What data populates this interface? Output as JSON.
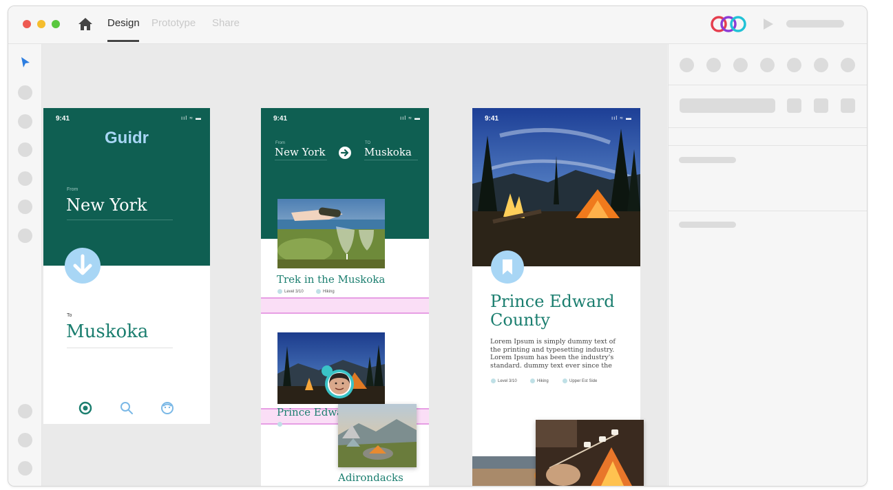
{
  "titlebar": {
    "tabs": [
      {
        "label": "Design",
        "active": true
      },
      {
        "label": "Prototype",
        "active": false
      },
      {
        "label": "Share",
        "active": false
      }
    ],
    "traffic_lights": [
      "#ee5a52",
      "#f5bd2e",
      "#5ac73f"
    ]
  },
  "artboards": {
    "a1": {
      "time": "9:41",
      "status_icons": "ııl ≈ ▬",
      "app_name": "Guidr",
      "from_label": "From",
      "from_city": "New York",
      "to_label": "To",
      "to_city": "Muskoka"
    },
    "a2": {
      "time": "9:41",
      "status_icons": "ııl ≈ ▬",
      "from_label": "From",
      "from_city": "New York",
      "to_label": "TO",
      "to_city": "Muskoka",
      "card1_title": "Trek in the Muskoka",
      "card1_tag1": "Level 3/10",
      "card1_tag2": "Hiking",
      "card2_title": "Prince Edwa",
      "card3_title": "Adirondacks"
    },
    "a3": {
      "time": "9:41",
      "status_icons": "ııl ≈ ▬",
      "title": "Prince Edward County",
      "body": "Lorem Ipsum is simply dummy text of the printing and typesetting industry. Lorem Ipsum has been the industry's standard. dummy text ever since the",
      "tag1": "Level 3/10",
      "tag2": "Hiking",
      "tag3": "Upper Est Side"
    }
  },
  "colors": {
    "brand_green": "#0f5f52",
    "accent_teal": "#1b7e6f",
    "light_blue": "#a8d6f5"
  }
}
